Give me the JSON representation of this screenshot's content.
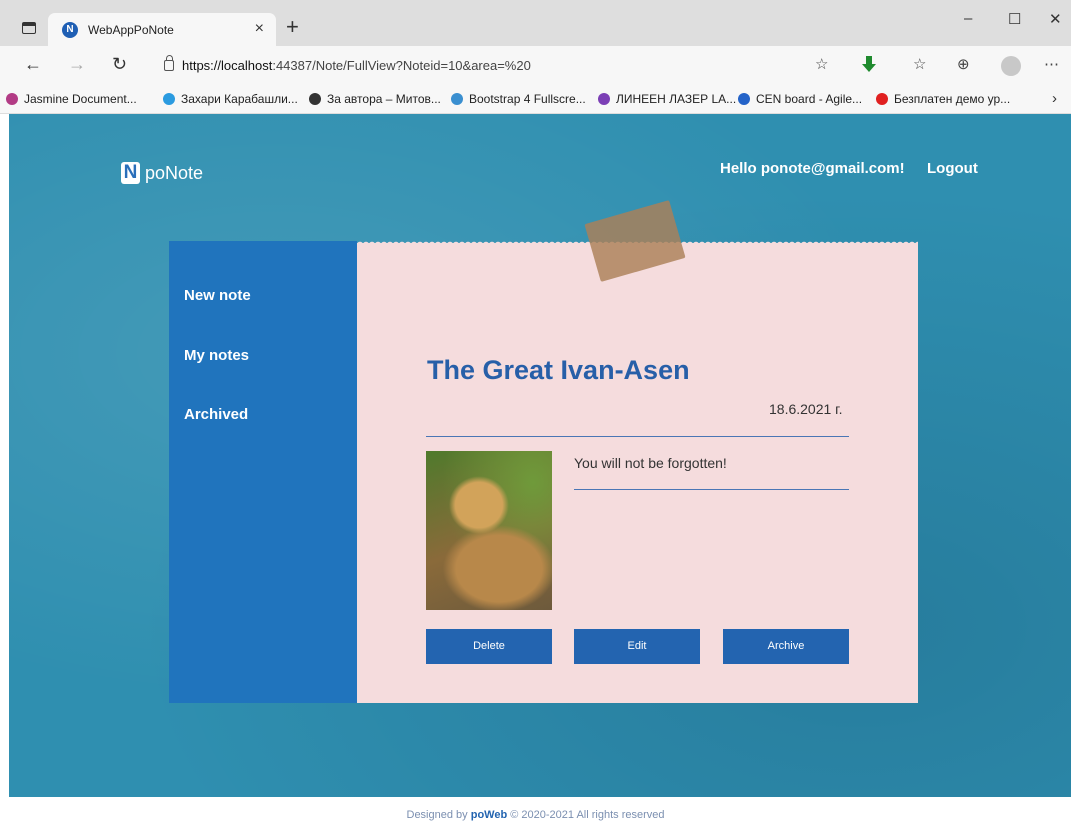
{
  "browser": {
    "tab_title": "WebAppPoNote",
    "tab_icon_letter": "N",
    "tab_close": "×",
    "new_tab": "+",
    "window_buttons": {
      "minimize": "–",
      "maximize": "☐",
      "close": "✕"
    },
    "url_host": "https://localhost",
    "url_rest": ":44387/Note/FullView?Noteid=10&area=%20",
    "bookmarks": [
      {
        "label": "Jasmine Document...",
        "color": "#b23b85"
      },
      {
        "label": "Захари Карабашли...",
        "color": "#2b9be0"
      },
      {
        "label": "За автора – Митов...",
        "color": "#333333"
      },
      {
        "label": "Bootstrap 4 Fullscre...",
        "color": "#3a8fd0"
      },
      {
        "label": "ЛИНЕЕН ЛАЗЕР LA...",
        "color": "#7b3fb5"
      },
      {
        "label": "CEN board - Agile...",
        "color": "#2463c8"
      },
      {
        "label": "Безплатен демо ур...",
        "color": "#e02020"
      }
    ],
    "bookmarks_more": "›"
  },
  "header": {
    "logo_letter": "N",
    "logo_text": "poNote",
    "greeting": "Hello ponote@gmail.com!",
    "logout": "Logout"
  },
  "sidebar": {
    "items": [
      {
        "label": "New note"
      },
      {
        "label": "My notes"
      },
      {
        "label": "Archived"
      }
    ]
  },
  "note": {
    "title": "The Great Ivan-Asen",
    "date": "18.6.2021 г.",
    "content": "You will not be forgotten!",
    "buttons": {
      "delete": "Delete",
      "edit": "Edit",
      "archive": "Archive"
    }
  },
  "footer": {
    "prefix": "Designed by",
    "brand": "poWeb",
    "suffix": "© 2020-2021 All rights reserved"
  },
  "colors": {
    "background": "#2f8fb0",
    "sidebar": "#2074bd",
    "note_paper": "#f5dcdd",
    "accent": "#2364b0"
  }
}
